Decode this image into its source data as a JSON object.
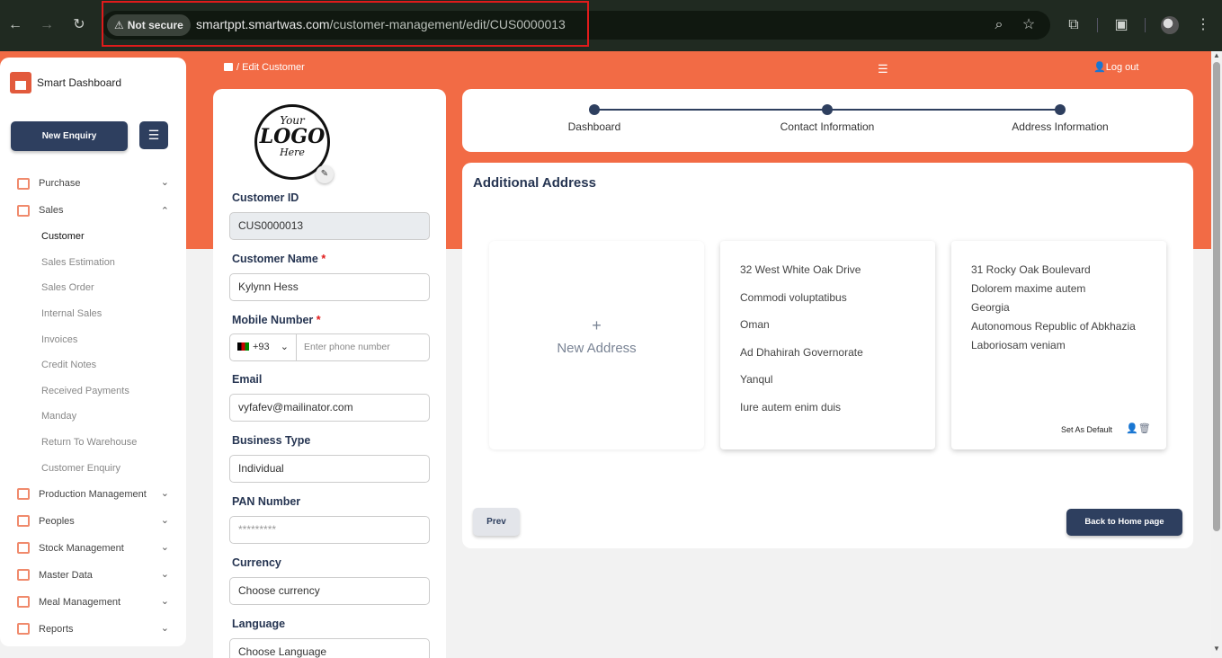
{
  "browser": {
    "not_secure_label": "Not secure",
    "url_domain": "smartppt.smartwas.com",
    "url_path": "/customer-management/edit/CUS0000013"
  },
  "sidebar": {
    "brand": "Smart Dashboard",
    "new_enquiry_label": "New Enquiry",
    "items": [
      {
        "label": "Purchase",
        "expanded": false
      },
      {
        "label": "Sales",
        "expanded": true
      }
    ],
    "sales_subitems": [
      "Customer",
      "Sales Estimation",
      "Sales Order",
      "Internal Sales",
      "Invoices",
      "Credit Notes",
      "Received Payments",
      "Manday",
      "Return To Warehouse",
      "Customer Enquiry"
    ],
    "active_subitem": "Customer",
    "more_items": [
      "Production Management",
      "Peoples",
      "Stock Management",
      "Master Data",
      "Meal Management",
      "Reports"
    ]
  },
  "header": {
    "breadcrumb": "/ Edit Customer",
    "logout_label": "Log out"
  },
  "form": {
    "logo_lines": [
      "Your",
      "LOGO",
      "Here"
    ],
    "customer_id_label": "Customer ID",
    "customer_id_value": "CUS0000013",
    "customer_name_label": "Customer Name",
    "customer_name_value": "Kylynn Hess",
    "mobile_label": "Mobile Number",
    "phone_code": "+93",
    "phone_placeholder": "Enter phone number",
    "email_label": "Email",
    "email_value": "vyfafev@mailinator.com",
    "business_type_label": "Business Type",
    "business_type_value": "Individual",
    "pan_label": "PAN Number",
    "pan_value": "*********",
    "currency_label": "Currency",
    "currency_value": "Choose currency",
    "language_label": "Language",
    "language_value": "Choose Language",
    "required_mark": "*"
  },
  "stepper": {
    "steps": [
      "Dashboard",
      "Contact Information",
      "Address Information"
    ]
  },
  "address": {
    "title": "Additional Address",
    "new_address_plus": "+",
    "new_address_label": "New Address",
    "address1": [
      "32 West White Oak Drive",
      "Commodi voluptatibus",
      "Oman",
      "Ad Dhahirah Governorate",
      "Yanqul",
      "Iure autem enim duis"
    ],
    "address2": [
      "31 Rocky Oak Boulevard",
      "Dolorem maxime autem",
      "Georgia",
      "Autonomous Republic of Abkhazia",
      "Laboriosam veniam"
    ],
    "set_default_label": "Set As Default",
    "prev_label": "Prev",
    "back_home_label": "Back to Home page"
  },
  "colors": {
    "accent": "#f26b45",
    "primary": "#2e3f5f"
  }
}
